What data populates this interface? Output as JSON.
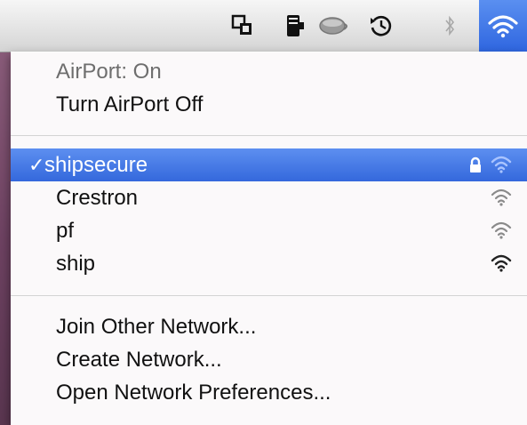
{
  "menubar": {
    "icons": [
      "window-switch-icon",
      "battery-icon",
      "bowl-icon",
      "time-machine-icon",
      "bluetooth-icon",
      "wifi-icon"
    ]
  },
  "menu": {
    "status_label": "AirPort: On",
    "toggle_label": "Turn AirPort Off",
    "networks": [
      {
        "name": "shipsecure",
        "selected": true,
        "locked": true,
        "signal": "full"
      },
      {
        "name": "Crestron",
        "selected": false,
        "locked": false,
        "signal": "full"
      },
      {
        "name": "pf",
        "selected": false,
        "locked": false,
        "signal": "full"
      },
      {
        "name": "ship",
        "selected": false,
        "locked": false,
        "signal": "full"
      }
    ],
    "check_mark": "✓",
    "actions": {
      "join_other": "Join Other Network...",
      "create": "Create Network...",
      "open_prefs": "Open Network Preferences..."
    }
  },
  "colors": {
    "selection": "#3468dc",
    "menubar_highlight": "#2f66e0",
    "desktop": "#7d4e6c"
  }
}
